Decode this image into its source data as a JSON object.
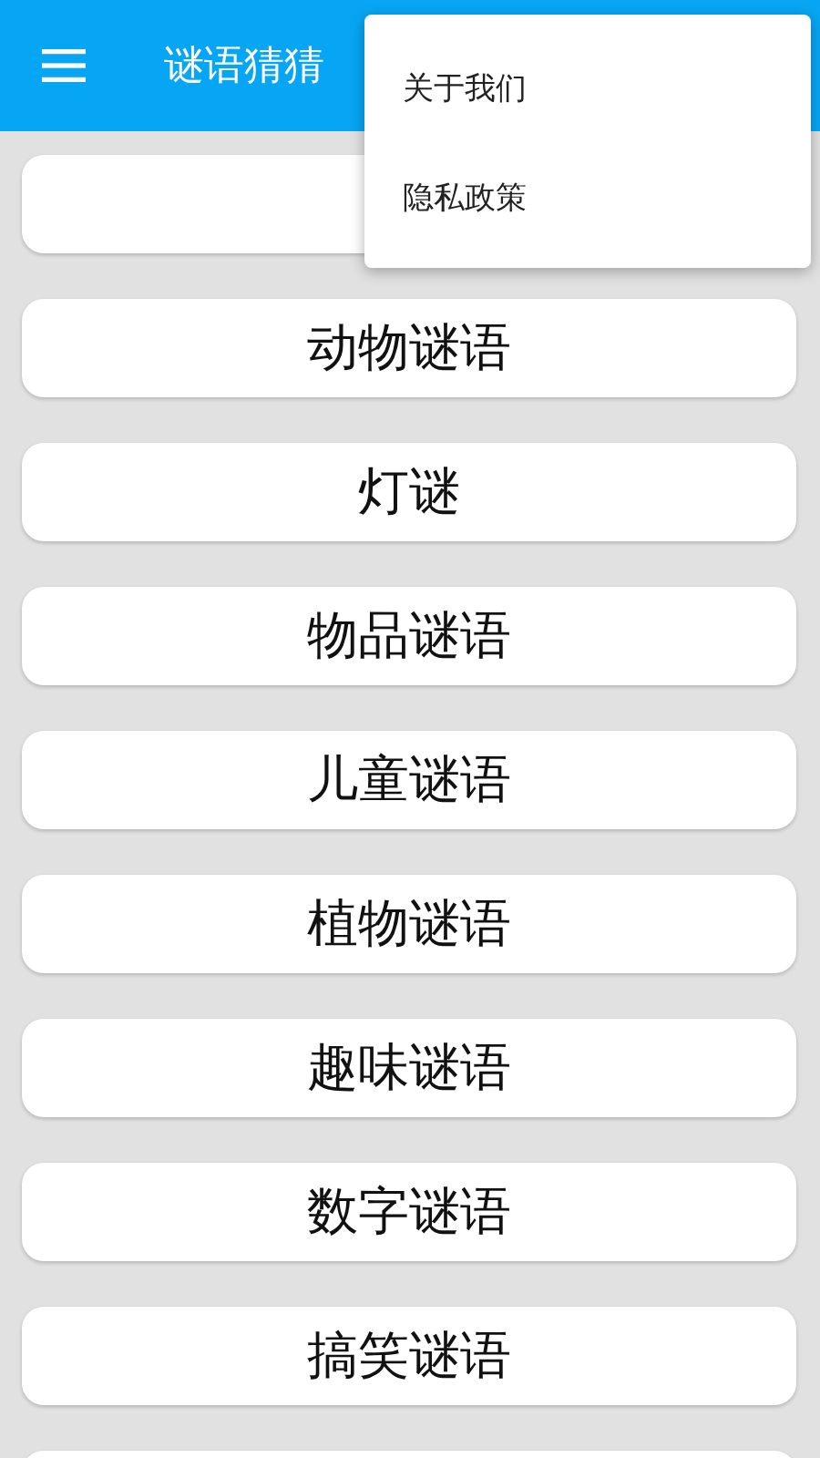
{
  "app_bar": {
    "title": "谜语猜猜"
  },
  "categories": [
    {
      "kind": "hidden"
    },
    {
      "kind": "label",
      "label": "动物谜语"
    },
    {
      "kind": "label",
      "label": "灯谜"
    },
    {
      "kind": "label",
      "label": "物品谜语"
    },
    {
      "kind": "label",
      "label": "儿童谜语"
    },
    {
      "kind": "label",
      "label": "植物谜语"
    },
    {
      "kind": "label",
      "label": "趣味谜语"
    },
    {
      "kind": "label",
      "label": "数字谜语"
    },
    {
      "kind": "label",
      "label": "搞笑谜语"
    },
    {
      "kind": "hidden"
    }
  ],
  "menu": {
    "items": [
      {
        "label": "关于我们"
      },
      {
        "label": "隐私政策"
      }
    ]
  }
}
